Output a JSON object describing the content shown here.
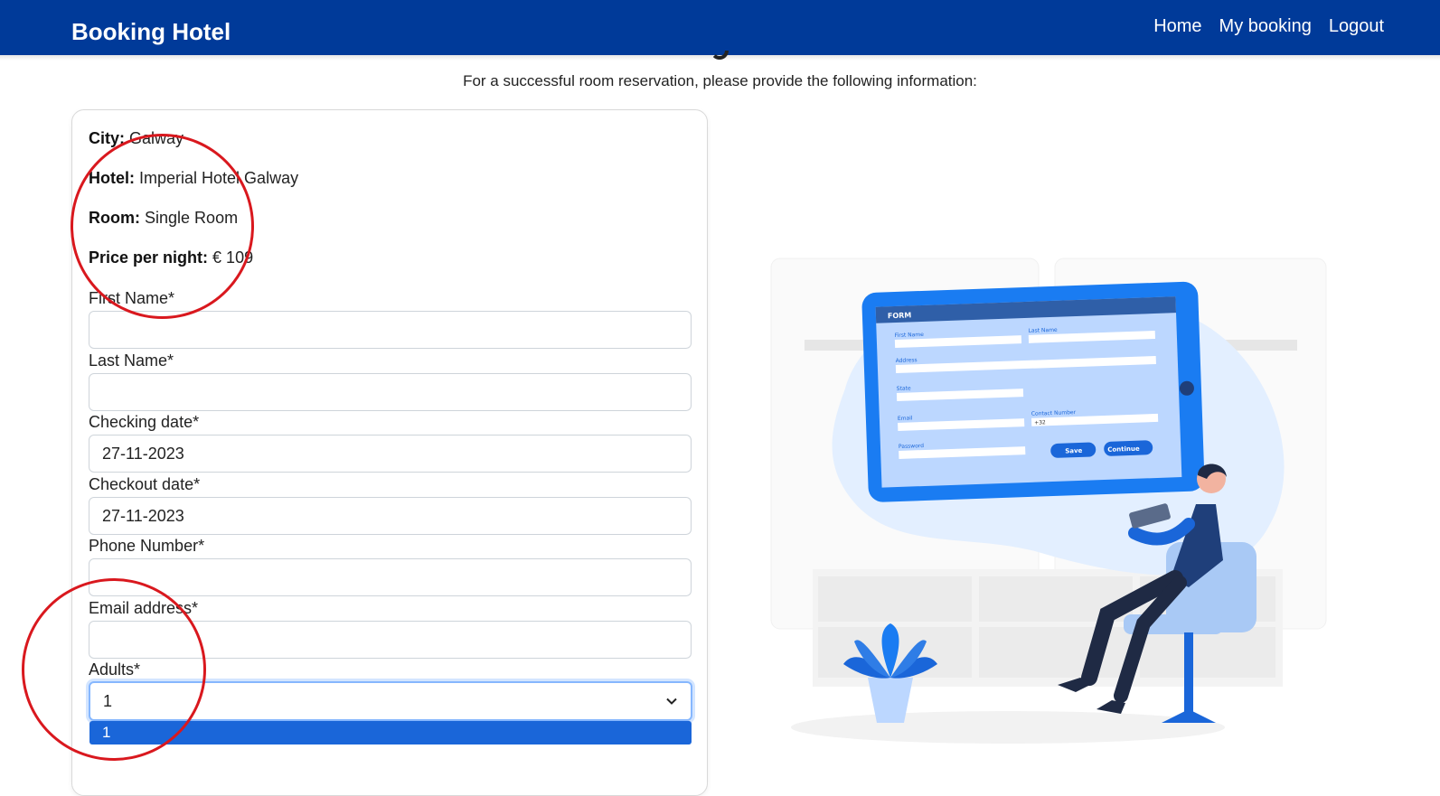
{
  "nav": {
    "brand": "Booking Hotel",
    "links": [
      "Home",
      "My booking",
      "Logout"
    ]
  },
  "intro": "For a successful room reservation, please provide the following information:",
  "summary": {
    "city_label": "City:",
    "city": "Galway",
    "hotel_label": "Hotel:",
    "hotel": "Imperial Hotel Galway",
    "room_label": "Room:",
    "room": "Single Room",
    "price_label": "Price per night:",
    "price": "€ 109"
  },
  "form": {
    "first_name_label": "First Name*",
    "first_name": "",
    "last_name_label": "Last Name*",
    "last_name": "",
    "checkin_label": "Checking date*",
    "checkin": "27-11-2023",
    "checkout_label": "Checkout date*",
    "checkout": "27-11-2023",
    "phone_label": "Phone Number*",
    "phone": "",
    "email_label": "Email address*",
    "email": "",
    "adults_label": "Adults*",
    "adults": "1",
    "adults_options": [
      "1"
    ]
  },
  "illustration": {
    "form_title": "FORM",
    "first_name": "First Name",
    "last_name": "Last Name",
    "address": "Address",
    "state": "State",
    "email": "Email",
    "contact": "Contact Number",
    "prefix": "+32",
    "password": "Password",
    "save": "Save",
    "continue": "Continue"
  },
  "colors": {
    "navbar": "#003a99",
    "accent": "#1a66d9",
    "annotation": "#d9181e"
  }
}
